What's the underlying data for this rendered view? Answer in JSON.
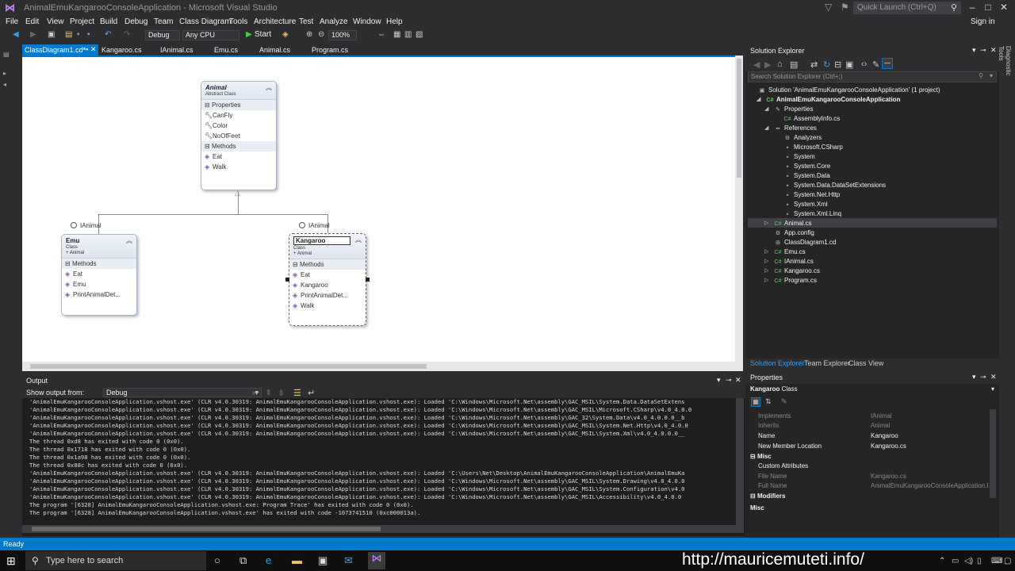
{
  "window": {
    "title": "AnimalEmuKangarooConsoleApplication - Microsoft Visual Studio",
    "quick_launch_placeholder": "Quick Launch (Ctrl+Q)",
    "sign_in": "Sign in"
  },
  "menu": [
    "File",
    "Edit",
    "View",
    "Project",
    "Build",
    "Debug",
    "Team",
    "Class Diagram",
    "Tools",
    "Architecture",
    "Test",
    "Analyze",
    "Window",
    "Help"
  ],
  "toolbar": {
    "config": "Debug",
    "platform": "Any CPU",
    "start": "Start",
    "zoom": "100%"
  },
  "tabs": [
    "ClassDiagram1.cd*",
    "Kangaroo.cs",
    "IAnimal.cs",
    "Emu.cs",
    "Animal.cs",
    "Program.cs"
  ],
  "diagram": {
    "animal": {
      "name": "Animal",
      "kind": "Abstract Class",
      "sections": [
        {
          "title": "Properties",
          "items": [
            "CanFly",
            "Color",
            "NoOfFeet"
          ]
        },
        {
          "title": "Methods",
          "items": [
            "Eat",
            "Walk"
          ]
        }
      ]
    },
    "emu": {
      "name": "Emu",
      "kind": "Class",
      "base": "+ Animal",
      "interface": "IAnimal",
      "sections": [
        {
          "title": "Methods",
          "items": [
            "Eat",
            "Emu",
            "PrintAnimalDet..."
          ]
        }
      ]
    },
    "kangaroo": {
      "name": "Kangaroo",
      "kind": "Class",
      "base": "+ Animal",
      "interface": "IAnimal",
      "sections": [
        {
          "title": "Methods",
          "items": [
            "Eat",
            "Kangaroo",
            "PrintAnimalDet...",
            "Walk"
          ]
        }
      ]
    }
  },
  "solution_explorer": {
    "title": "Solution Explorer",
    "search_placeholder": "Search Solution Explorer (Ctrl+;)",
    "tree": [
      {
        "label": "Solution 'AnimalEmuKangarooConsoleApplication' (1 project)",
        "level": 0,
        "bold": false
      },
      {
        "label": "AnimalEmuKangarooConsoleApplication",
        "level": 1,
        "bold": true
      },
      {
        "label": "Properties",
        "level": 2,
        "bold": false
      },
      {
        "label": "AssemblyInfo.cs",
        "level": 3,
        "bold": false
      },
      {
        "label": "References",
        "level": 2,
        "bold": false
      },
      {
        "label": "Analyzers",
        "level": 3,
        "bold": false
      },
      {
        "label": "Microsoft.CSharp",
        "level": 3,
        "bold": false
      },
      {
        "label": "System",
        "level": 3,
        "bold": false
      },
      {
        "label": "System.Core",
        "level": 3,
        "bold": false
      },
      {
        "label": "System.Data",
        "level": 3,
        "bold": false
      },
      {
        "label": "System.Data.DataSetExtensions",
        "level": 3,
        "bold": false
      },
      {
        "label": "System.Net.Http",
        "level": 3,
        "bold": false
      },
      {
        "label": "System.Xml",
        "level": 3,
        "bold": false
      },
      {
        "label": "System.Xml.Linq",
        "level": 3,
        "bold": false
      },
      {
        "label": "Animal.cs",
        "level": 2,
        "bold": false
      },
      {
        "label": "App.config",
        "level": 2,
        "bold": false
      },
      {
        "label": "ClassDiagram1.cd",
        "level": 2,
        "bold": false
      },
      {
        "label": "Emu.cs",
        "level": 2,
        "bold": false
      },
      {
        "label": "IAnimal.cs",
        "level": 2,
        "bold": false
      },
      {
        "label": "Kangaroo.cs",
        "level": 2,
        "bold": false
      },
      {
        "label": "Program.cs",
        "level": 2,
        "bold": false
      }
    ],
    "bottom_tabs": [
      "Solution Explorer",
      "Team Explorer",
      "Class View"
    ]
  },
  "output": {
    "title": "Output",
    "show_from_label": "Show output from:",
    "source": "Debug",
    "lines": [
      "'AnimalEmuKangarooConsoleApplication.vshost.exe' (CLR v4.0.30319: AnimalEmuKangarooConsoleApplication.vshost.exe): Loaded 'C:\\Windows\\Microsoft.Net\\assembly\\GAC_MSIL\\System.Data.DataSetExtens",
      "'AnimalEmuKangarooConsoleApplication.vshost.exe' (CLR v4.0.30319: AnimalEmuKangarooConsoleApplication.vshost.exe): Loaded 'C:\\Windows\\Microsoft.Net\\assembly\\GAC_MSIL\\Microsoft.CSharp\\v4.0_4.0.0",
      "'AnimalEmuKangarooConsoleApplication.vshost.exe' (CLR v4.0.30319: AnimalEmuKangarooConsoleApplication.vshost.exe): Loaded 'C:\\Windows\\Microsoft.Net\\assembly\\GAC_32\\System.Data\\v4.0_4.0.0.0__b",
      "'AnimalEmuKangarooConsoleApplication.vshost.exe' (CLR v4.0.30319: AnimalEmuKangarooConsoleApplication.vshost.exe): Loaded 'C:\\Windows\\Microsoft.Net\\assembly\\GAC_MSIL\\System.Net.Http\\v4.0_4.0.0",
      "'AnimalEmuKangarooConsoleApplication.vshost.exe' (CLR v4.0.30319: AnimalEmuKangarooConsoleApplication.vshost.exe): Loaded 'C:\\Windows\\Microsoft.Net\\assembly\\GAC_MSIL\\System.Xml\\v4.0_4.0.0.0__",
      "The thread 0xd8 has exited with code 0 (0x0).",
      "The thread 0x1718 has exited with code 0 (0x0).",
      "The thread 0x1a98 has exited with code 0 (0x0).",
      "The thread 0x88c has exited with code 0 (0x0).",
      "'AnimalEmuKangarooConsoleApplication.vshost.exe' (CLR v4.0.30319: AnimalEmuKangarooConsoleApplication.vshost.exe): Loaded 'C:\\Users\\Net\\Desktop\\AnimalEmuKangarooConsoleApplication\\AnimalEmuKa",
      "'AnimalEmuKangarooConsoleApplication.vshost.exe' (CLR v4.0.30319: AnimalEmuKangarooConsoleApplication.vshost.exe): Loaded 'C:\\Windows\\Microsoft.Net\\assembly\\GAC_MSIL\\System.Drawing\\v4.0_4.0.0",
      "'AnimalEmuKangarooConsoleApplication.vshost.exe' (CLR v4.0.30319: AnimalEmuKangarooConsoleApplication.vshost.exe): Loaded 'C:\\Windows\\Microsoft.Net\\assembly\\GAC_MSIL\\System.Configuration\\v4.0",
      "'AnimalEmuKangarooConsoleApplication.vshost.exe' (CLR v4.0.30319: AnimalEmuKangarooConsoleApplication.vshost.exe): Loaded 'C:\\Windows\\Microsoft.Net\\assembly\\GAC_MSIL\\Accessibility\\v4.0_4.0.0",
      "The program '[6328] AnimalEmuKangarooConsoleApplication.vshost.exe: Program Trace' has exited with code 0 (0x0).",
      "The program '[6328] AnimalEmuKangarooConsoleApplication.vshost.exe' has exited with code -1073741510 (0xc000013a)."
    ]
  },
  "properties": {
    "title": "Properties",
    "object_name": "Kangaroo",
    "object_type": "Class",
    "rows": [
      {
        "kind": "prop",
        "key": "Implements",
        "value": "IAnimal",
        "dim": true
      },
      {
        "kind": "prop",
        "key": "Inherits",
        "value": "Animal",
        "dim": true
      },
      {
        "kind": "prop",
        "key": "Name",
        "value": "Kangaroo",
        "dim": false
      },
      {
        "kind": "prop",
        "key": "New Member Location",
        "value": "Kangaroo.cs",
        "dim": false
      },
      {
        "kind": "cat",
        "key": "Misc",
        "value": "",
        "dim": false
      },
      {
        "kind": "prop",
        "key": "Custom Attributes",
        "value": "",
        "dim": false
      },
      {
        "kind": "prop",
        "key": "File Name",
        "value": "Kangaroo.cs",
        "dim": true
      },
      {
        "kind": "prop",
        "key": "Full Name",
        "value": "AnimalEmuKangarooConsoleApplication.K",
        "dim": true
      },
      {
        "kind": "cat",
        "key": "Modifiers",
        "value": "",
        "dim": false
      }
    ],
    "description_title": "Misc"
  },
  "status": "Ready",
  "taskbar": {
    "search_placeholder": "Type here to search",
    "watermark": "http://mauricemuteti.info/"
  }
}
